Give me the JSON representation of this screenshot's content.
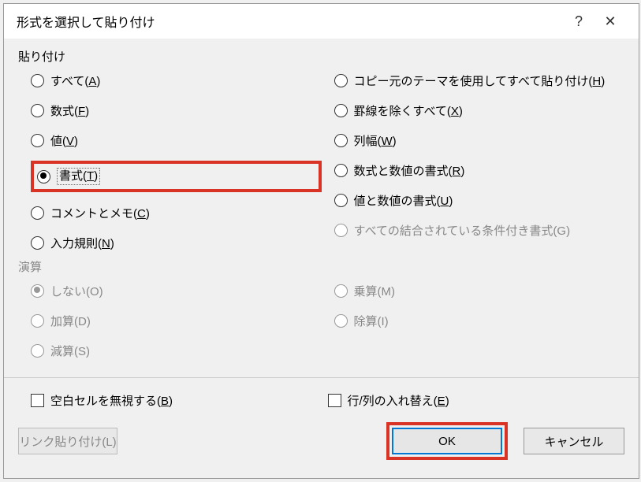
{
  "title": "形式を選択して貼り付け",
  "help_glyph": "?",
  "close_glyph": "✕",
  "groups": {
    "paste": {
      "title": "貼り付け",
      "left": [
        {
          "pre": "すべて(",
          "u": "A",
          "post": ")",
          "selected": false,
          "disabled": false,
          "highlight": false
        },
        {
          "pre": "数式(",
          "u": "F",
          "post": ")",
          "selected": false,
          "disabled": false,
          "highlight": false
        },
        {
          "pre": "値(",
          "u": "V",
          "post": ")",
          "selected": false,
          "disabled": false,
          "highlight": false
        },
        {
          "pre": "書式(",
          "u": "T",
          "post": ")",
          "selected": true,
          "disabled": false,
          "highlight": true,
          "focus": true
        },
        {
          "pre": "コメントとメモ(",
          "u": "C",
          "post": ")",
          "selected": false,
          "disabled": false,
          "highlight": false
        },
        {
          "pre": "入力規則(",
          "u": "N",
          "post": ")",
          "selected": false,
          "disabled": false,
          "highlight": false
        }
      ],
      "right": [
        {
          "pre": "コピー元のテーマを使用してすべて貼り付け(",
          "u": "H",
          "post": ")",
          "selected": false,
          "disabled": false
        },
        {
          "pre": "罫線を除くすべて(",
          "u": "X",
          "post": ")",
          "selected": false,
          "disabled": false
        },
        {
          "pre": "列幅(",
          "u": "W",
          "post": ")",
          "selected": false,
          "disabled": false
        },
        {
          "pre": "数式と数値の書式(",
          "u": "R",
          "post": ")",
          "selected": false,
          "disabled": false
        },
        {
          "pre": "値と数値の書式(",
          "u": "U",
          "post": ")",
          "selected": false,
          "disabled": false
        },
        {
          "pre": "すべての結合されている条件付き書式(G)",
          "u": "",
          "post": "",
          "selected": false,
          "disabled": true
        }
      ]
    },
    "operation": {
      "title": "演算",
      "disabled": true,
      "left": [
        {
          "pre": "しない(O)",
          "selected": true,
          "disabled": true
        },
        {
          "pre": "加算(D)",
          "selected": false,
          "disabled": true
        },
        {
          "pre": "減算(S)",
          "selected": false,
          "disabled": true
        }
      ],
      "right": [
        {
          "pre": "乗算(M)",
          "selected": false,
          "disabled": true
        },
        {
          "pre": "除算(I)",
          "selected": false,
          "disabled": true
        }
      ]
    }
  },
  "checks": {
    "skip_blanks": {
      "pre": "空白セルを無視する(",
      "u": "B",
      "post": ")",
      "checked": false
    },
    "transpose": {
      "pre": "行/列の入れ替え(",
      "u": "E",
      "post": ")",
      "checked": false
    }
  },
  "buttons": {
    "paste_link": "リンク貼り付け(L)",
    "ok": "OK",
    "cancel": "キャンセル"
  }
}
